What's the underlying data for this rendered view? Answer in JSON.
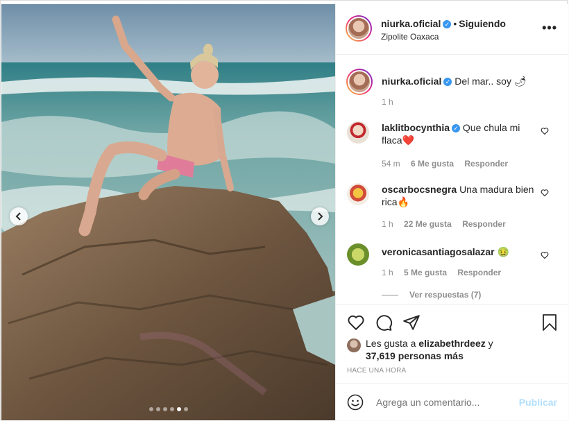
{
  "post": {
    "username": "niurka.oficial",
    "follow_status": "Siguiendo",
    "location": "Zipolite Oaxaca",
    "more_label": "•••",
    "caption": {
      "username": "niurka.oficial",
      "text": "Del mar.. soy 🌶",
      "time": "1 h"
    },
    "comments": [
      {
        "username": "laklitbocynthia",
        "text": "Que chula mi flaca❤️",
        "time": "54 m",
        "likes": "6 Me gusta",
        "reply": "Responder"
      },
      {
        "username": "oscarbocsnegra",
        "text": "Una madura bien rica🔥",
        "time": "1 h",
        "likes": "22 Me gusta",
        "reply": "Responder"
      },
      {
        "username": "veronicasantiagosalazar",
        "text": "🤢",
        "time": "1 h",
        "likes": "5 Me gusta",
        "reply": "Responder"
      }
    ],
    "view_replies": "Ver respuestas (7)",
    "likes_prefix": "Les gusta a ",
    "likes_user": "elizabethrdeez",
    "likes_suffix": " y",
    "likes_count": "37,619 personas más",
    "time_ago": "HACE UNA HORA",
    "comment_placeholder": "Agrega un comentario...",
    "publish_label": "Publicar",
    "carousel": {
      "total": 6,
      "active_index": 4
    }
  },
  "colors": {
    "accent": "#3897f0",
    "publish_disabled": "#b2dffc",
    "muted": "#8e8e8e"
  },
  "icons": [
    "chevron-left-icon",
    "chevron-right-icon",
    "heart-icon",
    "comment-icon",
    "share-icon",
    "bookmark-icon",
    "emoji-icon",
    "more-icon",
    "verified-icon"
  ]
}
